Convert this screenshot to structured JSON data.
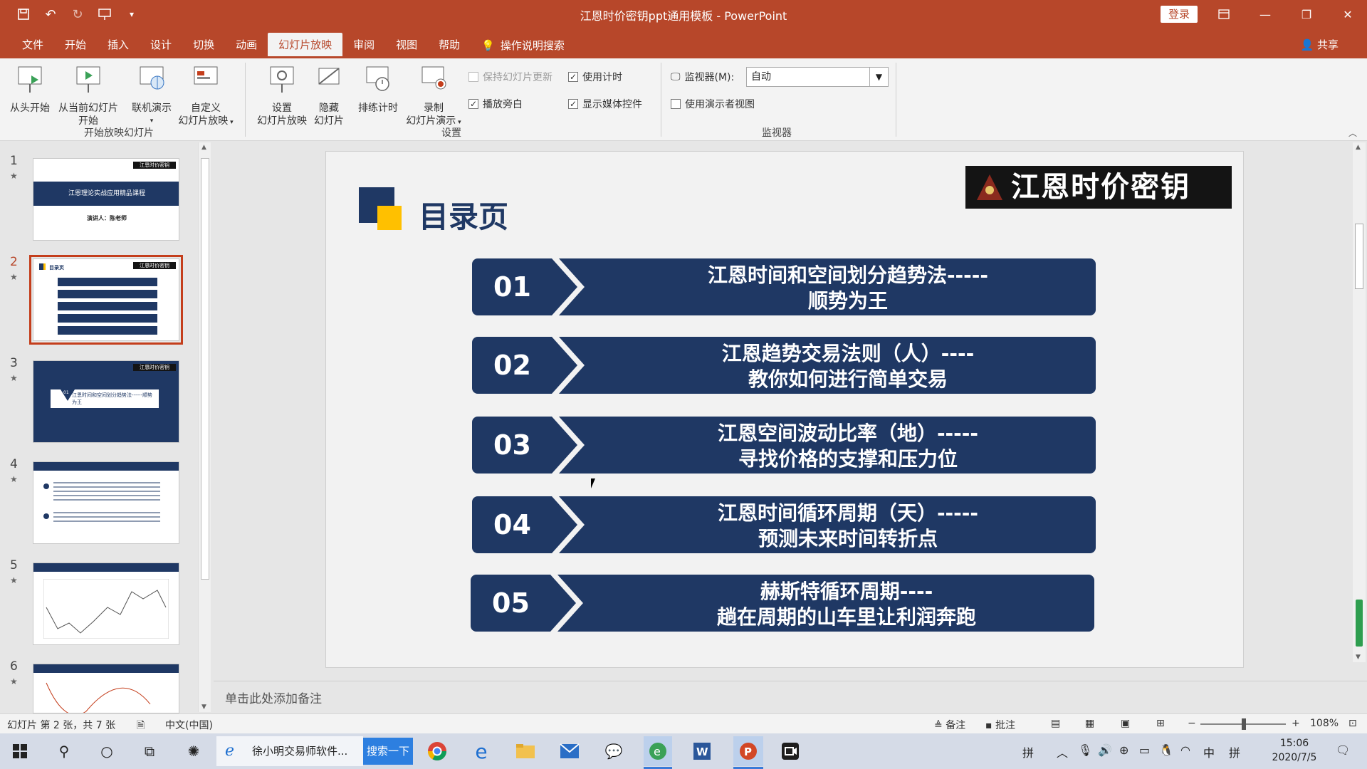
{
  "window": {
    "title": "江恩时价密钥ppt通用模板 - PowerPoint",
    "login": "登录"
  },
  "tabs": [
    "文件",
    "开始",
    "插入",
    "设计",
    "切换",
    "动画",
    "幻灯片放映",
    "审阅",
    "视图",
    "帮助"
  ],
  "tab_search": "操作说明搜索",
  "share": "共享",
  "ribbon": {
    "from_start": "从头开始",
    "from_current_l1": "从当前幻灯片",
    "from_current_l2": "开始",
    "online_present": "联机演示",
    "custom_show_l1": "自定义",
    "custom_show_l2": "幻灯片放映",
    "group_start": "开始放映幻灯片",
    "setup_show_l1": "设置",
    "setup_show_l2": "幻灯片放映",
    "hide_slide_l1": "隐藏",
    "hide_slide_l2": "幻灯片",
    "rehearse": "排练计时",
    "record_l1": "录制",
    "record_l2": "幻灯片演示",
    "keep_updated": "保持幻灯片更新",
    "use_timings": "使用计时",
    "play_narration": "播放旁白",
    "show_media": "显示媒体控件",
    "group_setup": "设置",
    "monitor_label": "监视器(M):",
    "monitor_value": "自动",
    "presenter_view": "使用演示者视图",
    "group_monitor": "监视器"
  },
  "slide": {
    "title": "目录页",
    "brand": "江恩时价密钥",
    "items": [
      {
        "num": "01",
        "line1": "江恩时间和空间划分趋势法-----",
        "line2": "顺势为王"
      },
      {
        "num": "02",
        "line1": "江恩趋势交易法则（人）----",
        "line2": "教你如何进行简单交易"
      },
      {
        "num": "03",
        "line1": "江恩空间波动比率（地）-----",
        "line2": "寻找价格的支撑和压力位"
      },
      {
        "num": "04",
        "line1": "江恩时间循环周期（天）-----",
        "line2": "预测未来时间转折点"
      },
      {
        "num": "05",
        "line1": "赫斯特循环周期----",
        "line2": "趟在周期的山车里让利润奔跑"
      }
    ]
  },
  "thumbnails": {
    "numbers": [
      "1",
      "2",
      "3",
      "4",
      "5",
      "6"
    ],
    "t1_title": "江恩理论实战应用精品课程",
    "t1_speaker": "演讲人：陈老师",
    "brand_small": "江恩时价密钥",
    "toc_small": "目录页",
    "t3_text": "江恩时间和空间划分趋势法------顺势为王",
    "t3_num": "01"
  },
  "notes": "单击此处添加备注",
  "status": {
    "slide_info": "幻灯片 第 2 张，共 7 张",
    "language": "中文(中国)",
    "notes_btn": "备注",
    "comments_btn": "批注",
    "zoom": "108%"
  },
  "taskbar": {
    "search_app": "徐小明交易师软件...",
    "search_btn": "搜索一下",
    "ime1": "拼",
    "ime2": "中",
    "ime3": "拼",
    "time": "15:06",
    "date": "2020/7/5"
  }
}
